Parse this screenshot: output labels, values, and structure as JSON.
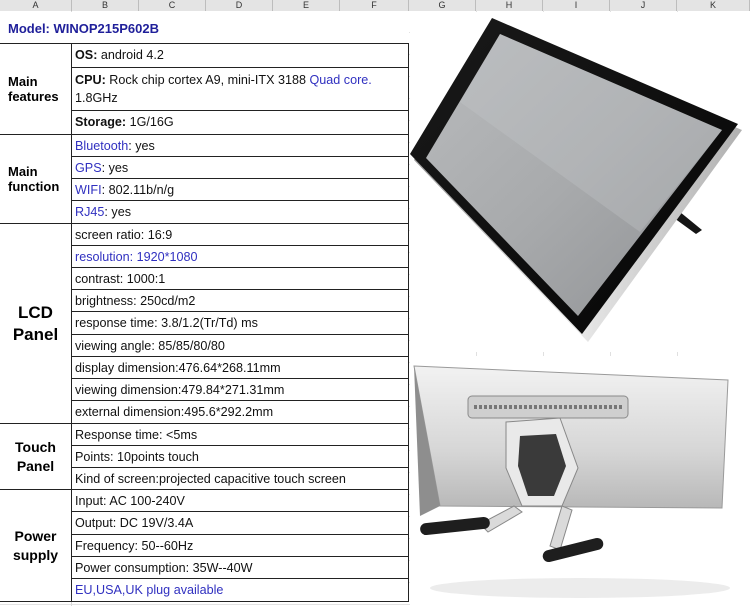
{
  "columns": [
    "A",
    "B",
    "C",
    "D",
    "E",
    "F",
    "G",
    "H",
    "I",
    "J",
    "K"
  ],
  "model": "Model: WINOP215P602B",
  "sections": [
    {
      "label": "Main features",
      "rows": [
        {
          "key": "OS:",
          "val": " android 4.2"
        },
        {
          "key": "CPU:",
          "val": " Rock chip cortex A9,  mini-ITX 3188 ",
          "blue": "Quad core.",
          "val2": "1.8GHz"
        },
        {
          "key": "Storage:",
          "val": " 1G/16G"
        }
      ]
    },
    {
      "label": "Main function",
      "rows": [
        {
          "blue": "Bluetooth",
          "val": ": yes"
        },
        {
          "blue": "GPS",
          "val": ": yes"
        },
        {
          "blue": "WIFI",
          "val": ": 802.11b/n/g"
        },
        {
          "blue": "RJ45",
          "val": ": yes"
        }
      ]
    },
    {
      "label": "LCD Panel",
      "rows": [
        {
          "val": "screen ratio: 16:9"
        },
        {
          "blue": "resolution: 1920*1080"
        },
        {
          "val": "contrast: 1000:1"
        },
        {
          "val": "brightness: 250cd/m2"
        },
        {
          "val": "response time: 3.8/1.2(Tr/Td) ms"
        },
        {
          "val": "viewing angle: 85/85/80/80"
        },
        {
          "val": "display dimension:476.64*268.11mm"
        },
        {
          "val": "viewing dimension:479.84*271.31mm"
        },
        {
          "val": "external dimension:495.6*292.2mm"
        }
      ]
    },
    {
      "label": "Touch Panel",
      "rows": [
        {
          "val": "Response time: <5ms"
        },
        {
          "val": "Points: 10points touch"
        },
        {
          "val": "Kind of screen:projected capacitive touch screen"
        }
      ]
    },
    {
      "label": "Power supply",
      "rows": [
        {
          "val": "Input: AC 100-240V"
        },
        {
          "val": "Output: DC 19V/3.4A"
        },
        {
          "val": "Frequency: 50--60Hz"
        },
        {
          "val": "Power consumption: 35W--40W"
        },
        {
          "blue": "EU,USA,UK plug available"
        }
      ]
    }
  ]
}
